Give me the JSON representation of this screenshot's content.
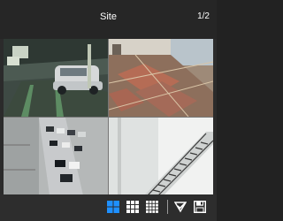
{
  "header": {
    "title": "Site",
    "page_indicator": "1/2"
  },
  "cameras": [
    {
      "name": "camera-tile-1",
      "scene": "underground-parking-car"
    },
    {
      "name": "camera-tile-2",
      "scene": "lobby-floor"
    },
    {
      "name": "camera-tile-3",
      "scene": "parking-lot-aerial"
    },
    {
      "name": "camera-tile-4",
      "scene": "stairwell"
    }
  ],
  "toolbar": {
    "active_layout": "2x2",
    "buttons": [
      "layout-2x2-icon",
      "layout-3x3-icon",
      "layout-4x4-icon",
      "favorite-check-icon",
      "save-icon"
    ],
    "accent": "#1e90ff",
    "icon_color": "#ffffff"
  }
}
